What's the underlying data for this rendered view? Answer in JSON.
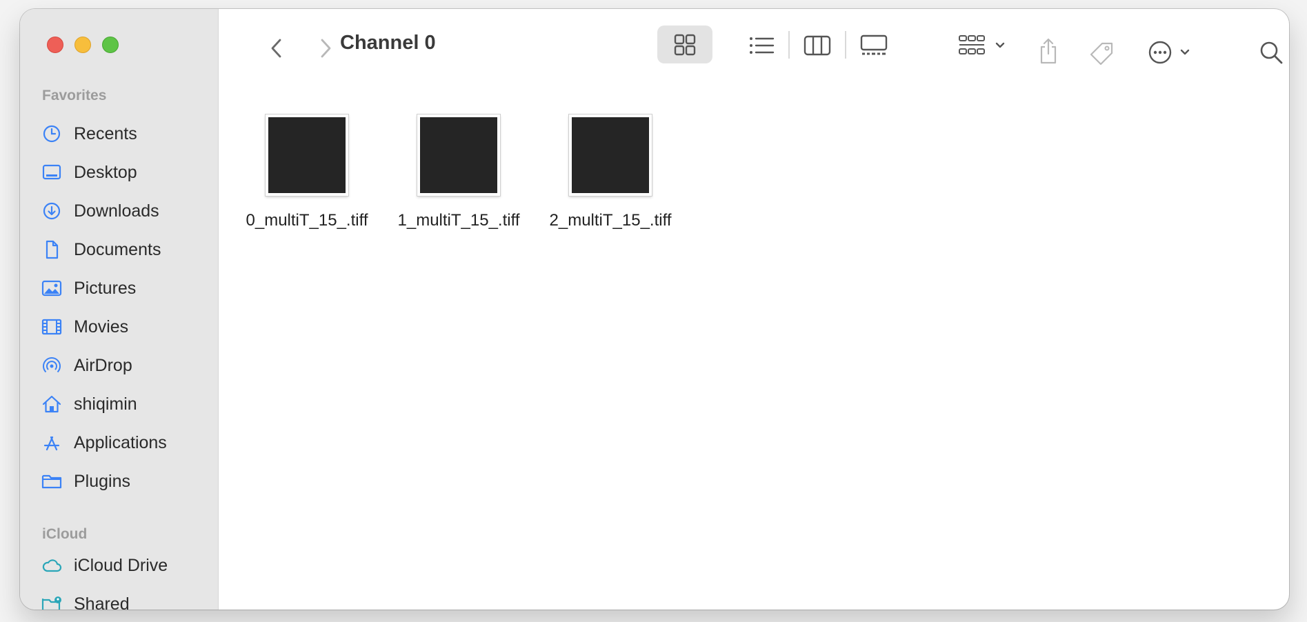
{
  "window": {
    "title": "Channel 0"
  },
  "sidebar": {
    "favorites_header": "Favorites",
    "favorites": [
      {
        "label": "Recents",
        "icon": "clock-icon"
      },
      {
        "label": "Desktop",
        "icon": "desktop-icon"
      },
      {
        "label": "Downloads",
        "icon": "download-icon"
      },
      {
        "label": "Documents",
        "icon": "document-icon"
      },
      {
        "label": "Pictures",
        "icon": "photo-icon"
      },
      {
        "label": "Movies",
        "icon": "film-icon"
      },
      {
        "label": "AirDrop",
        "icon": "airdrop-icon"
      },
      {
        "label": "shiqimin",
        "icon": "home-icon"
      },
      {
        "label": "Applications",
        "icon": "applications-icon"
      },
      {
        "label": "Plugins",
        "icon": "folder-icon"
      }
    ],
    "icloud_header": "iCloud",
    "icloud": [
      {
        "label": "iCloud Drive",
        "icon": "cloud-icon"
      },
      {
        "label": "Shared",
        "icon": "shared-folder-icon"
      }
    ]
  },
  "toolbar": {
    "view_mode_selected": "icons",
    "accent_color": "#3b82f6"
  },
  "files": [
    {
      "name": "0_multiT_15_.tiff"
    },
    {
      "name": "1_multiT_15_.tiff"
    },
    {
      "name": "2_multiT_15_.tiff"
    }
  ]
}
